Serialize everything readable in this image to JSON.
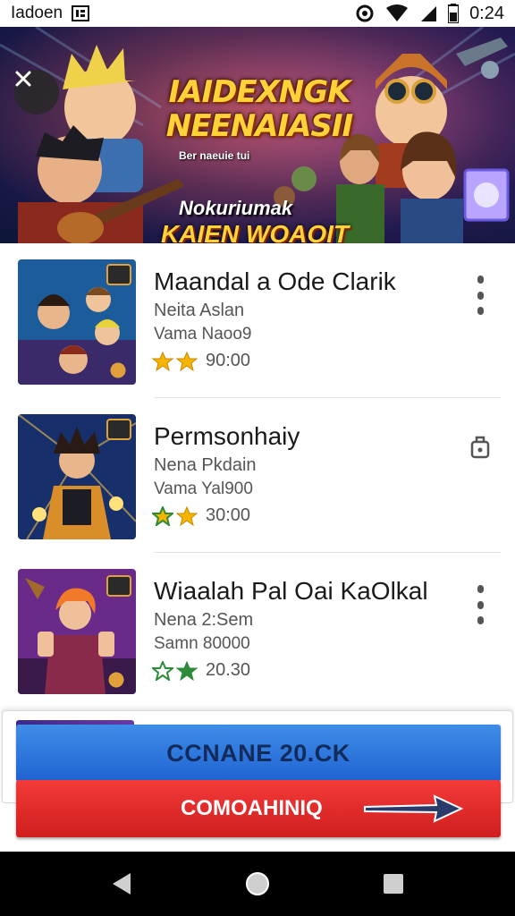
{
  "status_bar": {
    "carrier": "Iadoen",
    "time": "0:24",
    "icons": [
      "notification-box-icon",
      "sync-icon",
      "wifi-icon",
      "signal-icon",
      "battery-icon"
    ]
  },
  "banner": {
    "title": "IAIDEXNGK NEENAIASII",
    "subtitle": "Ber naeuie tui",
    "tagline_top": "Nokuriumak",
    "tagline_bottom": "KAIEN WOAOIT",
    "close_icon": "close-icon"
  },
  "items": [
    {
      "title": "Maandal a Ode Clarik",
      "line1": "Neita Aslan",
      "line2": "Vama Naoo9",
      "rating": "90:00",
      "stars": [
        1,
        1
      ],
      "action_icon": "more-vert-icon",
      "thumb_colors": [
        "#1d5c9a",
        "#e1a13a"
      ]
    },
    {
      "title": "Permsonhaiy",
      "line1": "Nena Pkdain",
      "line2": "Vama Yal900",
      "rating": "30:00",
      "stars": [
        0.5,
        1
      ],
      "action_icon": "lock-icon",
      "thumb_colors": [
        "#17306b",
        "#d98e2a"
      ]
    },
    {
      "title": "Wiaalah Pal Oai KaOlkal",
      "line1": "Nena 2:Sem",
      "line2": "Samn 80000",
      "rating": "20.30",
      "stars": [
        0.5,
        0.5
      ],
      "action_icon": "more-vert-icon",
      "thumb_colors": [
        "#6a2a8a",
        "#f07a2a"
      ]
    }
  ],
  "cta": {
    "primary_label": "CCNANE 20.CK",
    "secondary_label": "COMOAHINIQ",
    "arrow_icon": "arrow-right-icon"
  },
  "nav": {
    "icons": [
      "back-icon",
      "home-icon",
      "recents-icon"
    ]
  },
  "colors": {
    "primary_button": "#2a72de",
    "secondary_button": "#e42a2a",
    "star": "#f4b400",
    "star_outline": "#2e8b3a"
  }
}
